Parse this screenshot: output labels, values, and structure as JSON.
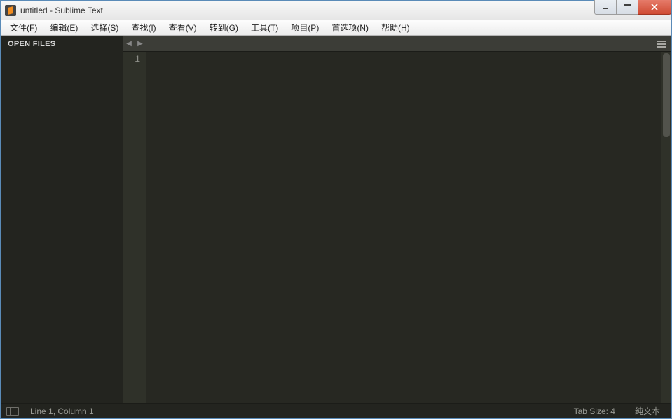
{
  "titlebar": {
    "title": "untitled - Sublime Text"
  },
  "menu": {
    "items": [
      "文件(F)",
      "编辑(E)",
      "选择(S)",
      "查找(I)",
      "查看(V)",
      "转到(G)",
      "工具(T)",
      "项目(P)",
      "首选项(N)",
      "帮助(H)"
    ]
  },
  "sidebar": {
    "header": "OPEN FILES"
  },
  "editor": {
    "line_numbers": [
      "1"
    ]
  },
  "statusbar": {
    "position": "Line 1, Column 1",
    "tab_size": "Tab Size: 4",
    "syntax": "纯文本"
  }
}
